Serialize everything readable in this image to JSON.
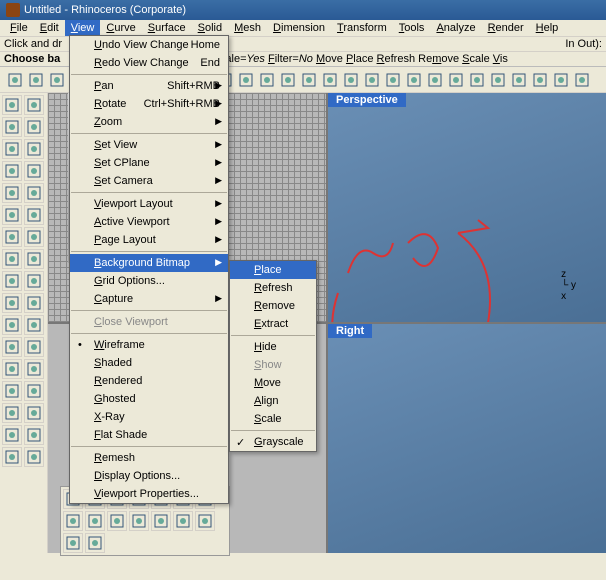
{
  "title": "Untitled - Rhinoceros (Corporate)",
  "menubar": [
    "File",
    "Edit",
    "View",
    "Curve",
    "Surface",
    "Solid",
    "Mesh",
    "Dimension",
    "Transform",
    "Tools",
    "Analyze",
    "Render",
    "Help"
  ],
  "cmdline_prefix": "Click and dr",
  "cmdline_suffix": "In Out):",
  "prompt": "Choose ba",
  "opts_html": "Extract <u>G</u>rayscale=<i>Yes</i> <u>F</u>ilter=<i>No</i> <u>M</u>ove <u>P</u>lace <u>R</u>efresh Re<u>m</u>ove <u>S</u>cale <u>V</u>is",
  "vp_persp": "Perspective",
  "vp_right": "Right",
  "view_menu": [
    {
      "t": "item",
      "label": "Undo View Change",
      "shortcut": "Home"
    },
    {
      "t": "item",
      "label": "Redo View Change",
      "shortcut": "End"
    },
    {
      "t": "sep"
    },
    {
      "t": "item",
      "label": "Pan",
      "shortcut": "Shift+RMB",
      "arrow": true
    },
    {
      "t": "item",
      "label": "Rotate",
      "shortcut": "Ctrl+Shift+RMB",
      "arrow": true
    },
    {
      "t": "item",
      "label": "Zoom",
      "arrow": true
    },
    {
      "t": "sep"
    },
    {
      "t": "item",
      "label": "Set View",
      "arrow": true
    },
    {
      "t": "item",
      "label": "Set CPlane",
      "arrow": true
    },
    {
      "t": "item",
      "label": "Set Camera",
      "arrow": true
    },
    {
      "t": "sep"
    },
    {
      "t": "item",
      "label": "Viewport Layout",
      "arrow": true
    },
    {
      "t": "item",
      "label": "Active Viewport",
      "arrow": true
    },
    {
      "t": "item",
      "label": "Page Layout",
      "arrow": true
    },
    {
      "t": "sep"
    },
    {
      "t": "item",
      "label": "Background Bitmap",
      "arrow": true,
      "sel": true
    },
    {
      "t": "item",
      "label": "Grid Options..."
    },
    {
      "t": "item",
      "label": "Capture",
      "arrow": true
    },
    {
      "t": "sep"
    },
    {
      "t": "item",
      "label": "Close Viewport",
      "disabled": true
    },
    {
      "t": "sep"
    },
    {
      "t": "item",
      "label": "Wireframe",
      "dot": true
    },
    {
      "t": "item",
      "label": "Shaded"
    },
    {
      "t": "item",
      "label": "Rendered"
    },
    {
      "t": "item",
      "label": "Ghosted"
    },
    {
      "t": "item",
      "label": "X-Ray"
    },
    {
      "t": "item",
      "label": "Flat Shade"
    },
    {
      "t": "sep"
    },
    {
      "t": "item",
      "label": "Remesh"
    },
    {
      "t": "item",
      "label": "Display Options..."
    },
    {
      "t": "item",
      "label": "Viewport Properties..."
    }
  ],
  "sub_menu": [
    {
      "t": "item",
      "label": "Place",
      "sel": true
    },
    {
      "t": "item",
      "label": "Refresh"
    },
    {
      "t": "item",
      "label": "Remove"
    },
    {
      "t": "item",
      "label": "Extract"
    },
    {
      "t": "sep"
    },
    {
      "t": "item",
      "label": "Hide"
    },
    {
      "t": "item",
      "label": "Show",
      "disabled": true
    },
    {
      "t": "item",
      "label": "Move"
    },
    {
      "t": "item",
      "label": "Align"
    },
    {
      "t": "item",
      "label": "Scale"
    },
    {
      "t": "sep"
    },
    {
      "t": "item",
      "label": "Grayscale",
      "check": true
    }
  ],
  "top_icons": [
    "new",
    "open",
    "save",
    "print",
    "cut",
    "copy",
    "paste",
    "undo",
    "redo",
    "hand",
    "rotate",
    "zoom-window",
    "zoom-dynamic",
    "zoom-extents",
    "zoom-sel",
    "zoom-1",
    "zoom-target",
    "grid",
    "pan",
    "globe",
    "car",
    "sphere",
    "cplane",
    "key",
    "lock",
    "bulb",
    "layer",
    "render"
  ],
  "left_icons": [
    "arrow",
    "lasso",
    "point",
    "line",
    "polyline",
    "curve",
    "circle",
    "arc",
    "rect",
    "polygon",
    "ellipse",
    "plane",
    "box",
    "sphere",
    "cyl",
    "cone",
    "pipe",
    "text",
    "dim",
    "hatch",
    "bool",
    "trim",
    "split",
    "join",
    "explode",
    "fillet",
    "chamfer",
    "offset",
    "array",
    "mirror",
    "rotate3d",
    "scale3d",
    "move3d",
    "align3d"
  ],
  "bottom_icons": [
    "a",
    "b",
    "c",
    "d",
    "e",
    "f",
    "g",
    "h",
    "i",
    "j",
    "k",
    "l",
    "m",
    "n",
    "o",
    "p"
  ]
}
